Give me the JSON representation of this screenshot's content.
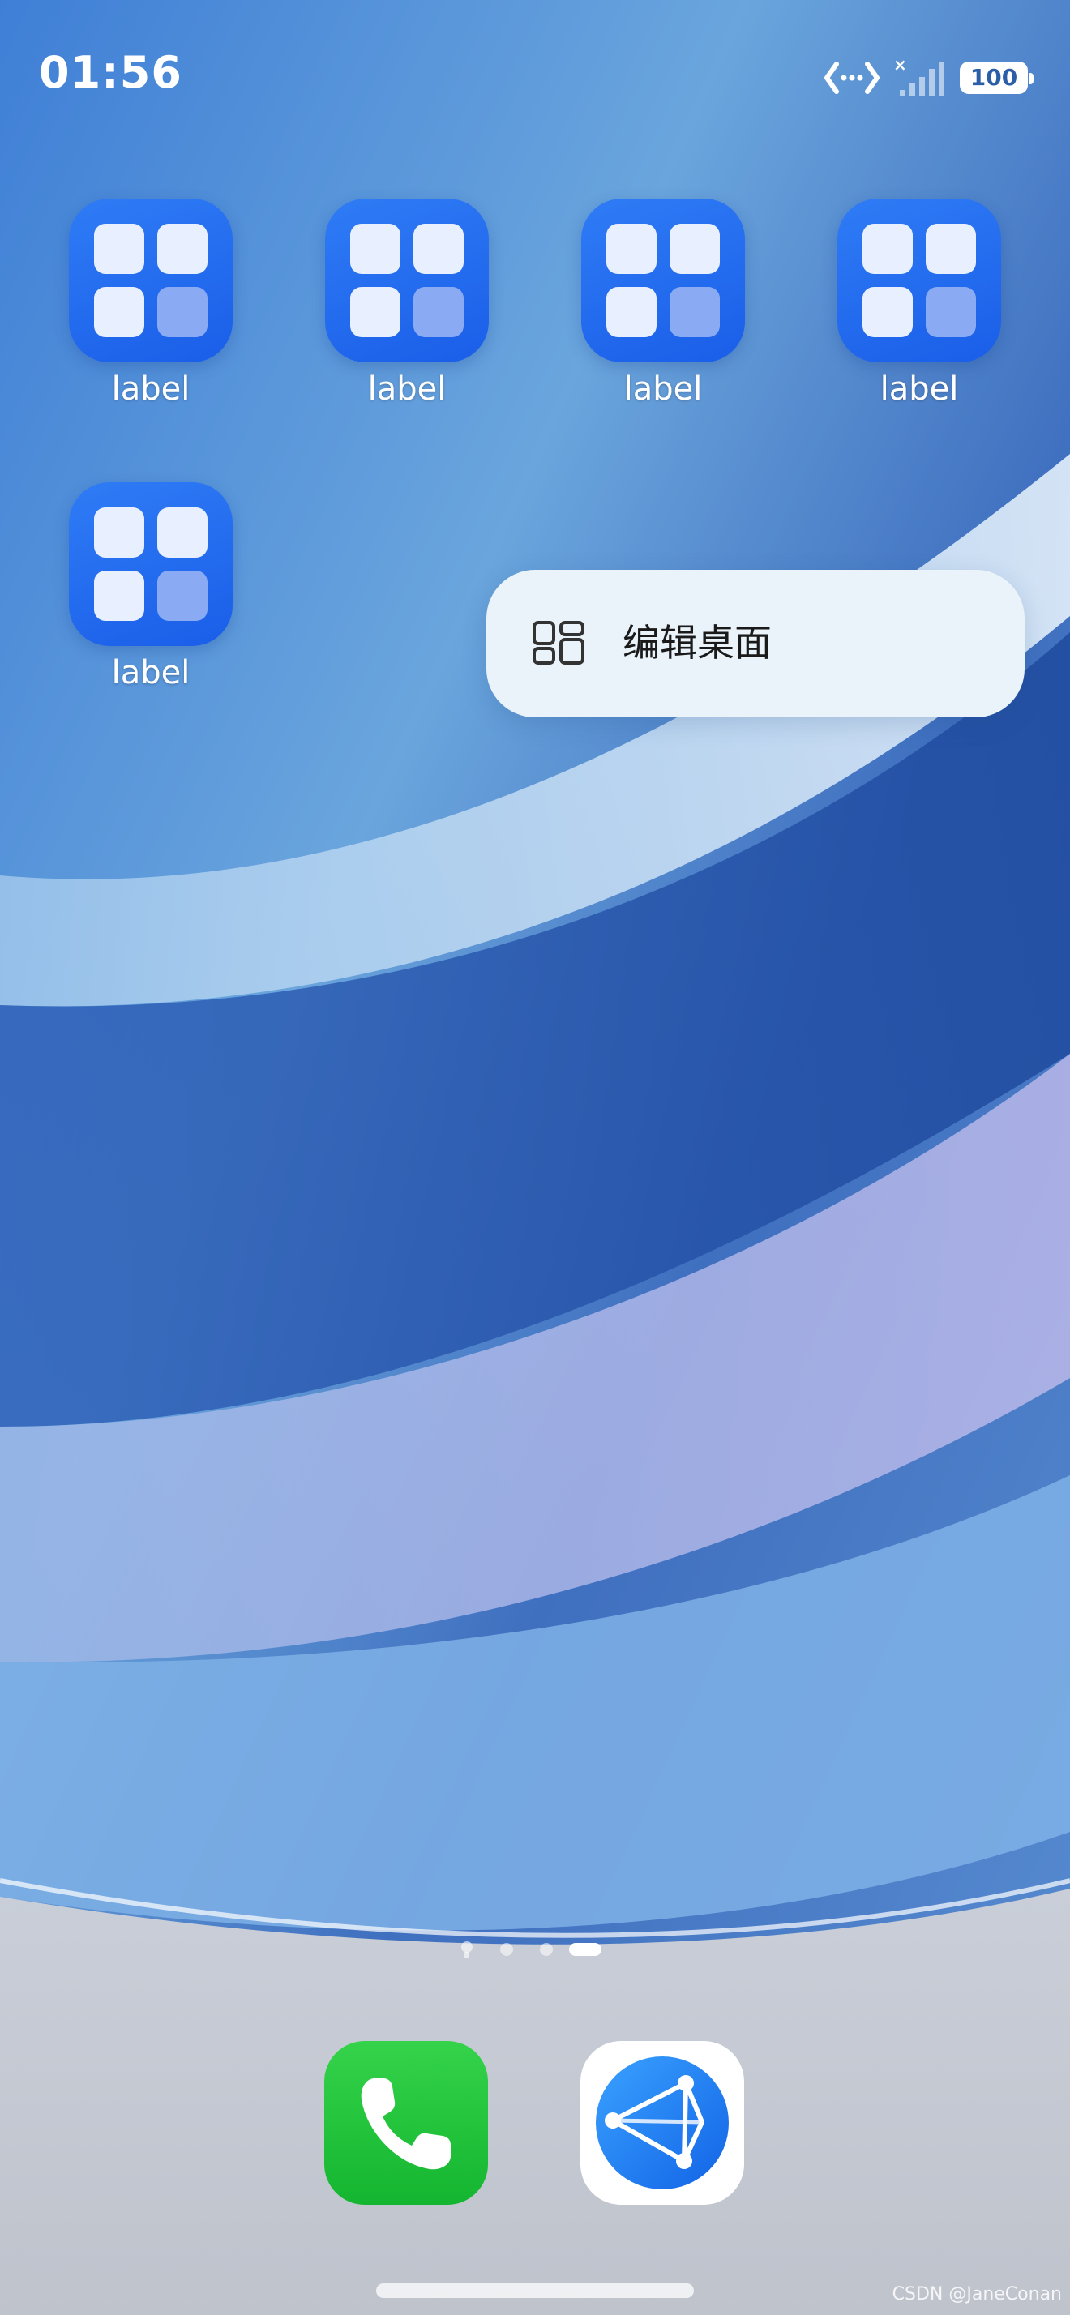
{
  "status_bar": {
    "time": "01:56",
    "battery": "100",
    "network_disconnected_mark": "×"
  },
  "apps": [
    {
      "label": "label",
      "icon": "grid-app-icon"
    },
    {
      "label": "label",
      "icon": "grid-app-icon"
    },
    {
      "label": "label",
      "icon": "grid-app-icon"
    },
    {
      "label": "label",
      "icon": "grid-app-icon"
    },
    {
      "label": "label",
      "icon": "grid-app-icon"
    }
  ],
  "context_menu": {
    "icon": "layout-grid-icon",
    "label": "编辑桌面"
  },
  "page_indicator": {
    "pages": 4,
    "active_index": 3,
    "first_is_search": true
  },
  "dock": {
    "apps": [
      {
        "icon": "phone-icon"
      },
      {
        "icon": "browser-globe-icon"
      }
    ]
  },
  "watermark": "CSDN @JaneConan",
  "colors": {
    "app_icon_blue": "#1a5ee8",
    "menu_bg": "#eaf3fa",
    "phone_green": "#14b530",
    "browser_blue": "#1a8cff"
  }
}
